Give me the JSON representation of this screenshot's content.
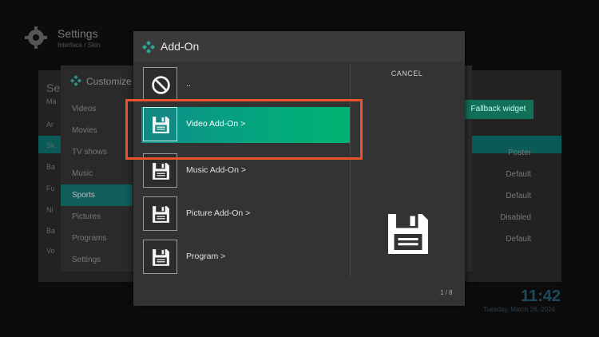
{
  "background": {
    "title": "Settings",
    "subtitle": "Interface / Skin",
    "side_letters": [
      "Se",
      "Ma",
      "Ar",
      "Sk",
      "Ba",
      "Fu",
      "Ni",
      "Ba",
      "Vo"
    ],
    "customize": {
      "title": "Customize",
      "items": [
        {
          "label": "Videos"
        },
        {
          "label": "Movies"
        },
        {
          "label": "TV shows"
        },
        {
          "label": "Music"
        },
        {
          "label": "Sports"
        },
        {
          "label": "Pictures"
        },
        {
          "label": "Programs"
        },
        {
          "label": "Settings"
        }
      ],
      "active_index": 4
    },
    "fallback_widget": "Fallback widget",
    "right_values": [
      "Poster",
      "Default",
      "Default",
      "Disabled",
      "Default"
    ],
    "clock": "11:42",
    "date": "Tuesday, March 26, 2024"
  },
  "dialog": {
    "title": "Add-On",
    "cancel_label": "CANCEL",
    "page_counter": "1 / 8",
    "items": [
      {
        "label": "..",
        "icon": "none-icon"
      },
      {
        "label": "Video Add-On  >",
        "icon": "floppy-icon"
      },
      {
        "label": "Music Add-On  >",
        "icon": "floppy-icon"
      },
      {
        "label": "Picture Add-On  >",
        "icon": "floppy-icon"
      },
      {
        "label": "Program  >",
        "icon": "floppy-icon"
      }
    ],
    "selected_index": 1
  },
  "colors": {
    "accent_from": "#0e8d8a",
    "accent_to": "#00b270",
    "highlight_frame": "#e8532b"
  }
}
